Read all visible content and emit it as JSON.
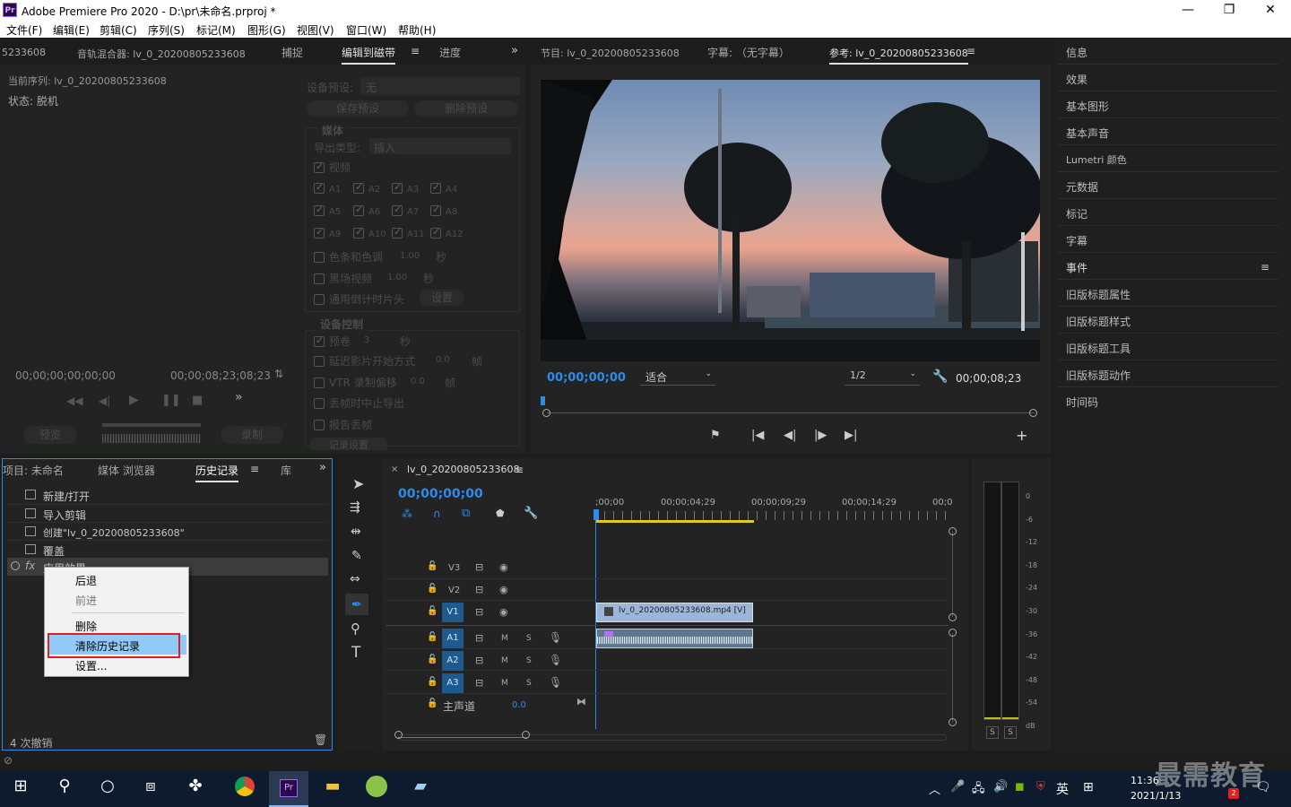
{
  "window": {
    "title": "Adobe Premiere Pro 2020 - D:\\pr\\未命名.prproj *",
    "app_icon": "Pr"
  },
  "menu": [
    "文件(F)",
    "编辑(E)",
    "剪辑(C)",
    "序列(S)",
    "标记(M)",
    "图形(G)",
    "视图(V)",
    "窗口(W)",
    "帮助(H)"
  ],
  "top_left_tabs": {
    "t0": "5233608",
    "t1": "音轨混合器: lv_0_20200805233608",
    "t2": "捕捉",
    "t3": "编辑到磁带",
    "t4": "进度"
  },
  "capture": {
    "seq_label": "当前序列: lv_0_20200805233608",
    "status": "状态: 脱机",
    "tc_left": "00;00;00;00;00;00",
    "tc_right": "00;00;08;23;08;23",
    "btn_preview": "预览",
    "btn_record": "录制"
  },
  "edit_tape": {
    "device_preset_label": "设备预设:",
    "device_preset_value": "无",
    "save_preset": "保存预设",
    "delete_preset": "删除预设",
    "media_header": "媒体",
    "export_type_label": "导出类型:",
    "export_type_value": "插入",
    "video": "视频",
    "audio": [
      "A1",
      "A2",
      "A3",
      "A4",
      "A5",
      "A6",
      "A7",
      "A8",
      "A9",
      "A10",
      "A11",
      "A12"
    ],
    "bars": "色条和色调",
    "bars_val": "1.00",
    "bars_unit": "秒",
    "black": "黑场视频",
    "black_val": "1.00",
    "black_unit": "秒",
    "countdown": "通用倒计时片头",
    "settings": "设置",
    "device_ctrl_header": "设备控制",
    "preroll": "预卷",
    "preroll_val": "3",
    "preroll_unit": "秒",
    "delay": "延迟影片开始方式",
    "delay_val": "0.0",
    "delay_unit": "帧",
    "vtr": "VTR 录制偏移",
    "vtr_val": "0.0",
    "vtr_unit": "帧",
    "abort": "丢帧时中止导出",
    "report": "报告丢帧",
    "last": "记录设置"
  },
  "monitor_tabs": {
    "t1": "节目: lv_0_20200805233608",
    "t2": "字幕: （无字幕）",
    "t3": "参考: lv_0_20200805233608"
  },
  "monitor": {
    "tc_current": "00;00;00;00",
    "fit": "适合",
    "quality": "1/2",
    "tc_duration": "00;00;08;23"
  },
  "right_panel": [
    "信息",
    "效果",
    "基本图形",
    "基本声音",
    "Lumetri 颜色",
    "元数据",
    "标记",
    "字幕",
    "事件",
    "旧版标题属性",
    "旧版标题样式",
    "旧版标题工具",
    "旧版标题动作",
    "时间码"
  ],
  "bottom_left_tabs": {
    "t1": "项目: 未命名",
    "t2": "媒体 浏览器",
    "t3": "历史记录",
    "t4": "库"
  },
  "history": [
    "新建/打开",
    "导入剪辑",
    "创建\"lv_0_20200805233608\"",
    "覆盖",
    "应用效果"
  ],
  "history_footer": "4 次撤销",
  "context_menu": {
    "undo": "后退",
    "redo": "前进",
    "delete": "删除",
    "clear": "清除历史记录",
    "settings": "设置..."
  },
  "timeline": {
    "tab": "lv_0_20200805233608",
    "tc": "00;00;00;00",
    "ruler": [
      ";00;00",
      "00;00;04;29",
      "00;00;09;29",
      "00;00;14;29",
      "00;0"
    ],
    "tracks_v": [
      "V3",
      "V2",
      "V1"
    ],
    "tracks_a": [
      "A1",
      "A2",
      "A3"
    ],
    "master": "主声道",
    "master_val": "0.0",
    "clip_v": "lv_0_20200805233608.mp4 [V]",
    "mute": "M",
    "solo": "S"
  },
  "meter": {
    "scale": [
      "0",
      "-6",
      "-12",
      "-18",
      "-24",
      "-30",
      "-36",
      "-42",
      "-48",
      "-54",
      "dB"
    ],
    "solo_l": "S",
    "solo_r": "S"
  },
  "taskbar": {
    "ime": "英",
    "time": "11:36",
    "date": "2021/1/13",
    "notif": "2",
    "watermark": "最需教育"
  }
}
